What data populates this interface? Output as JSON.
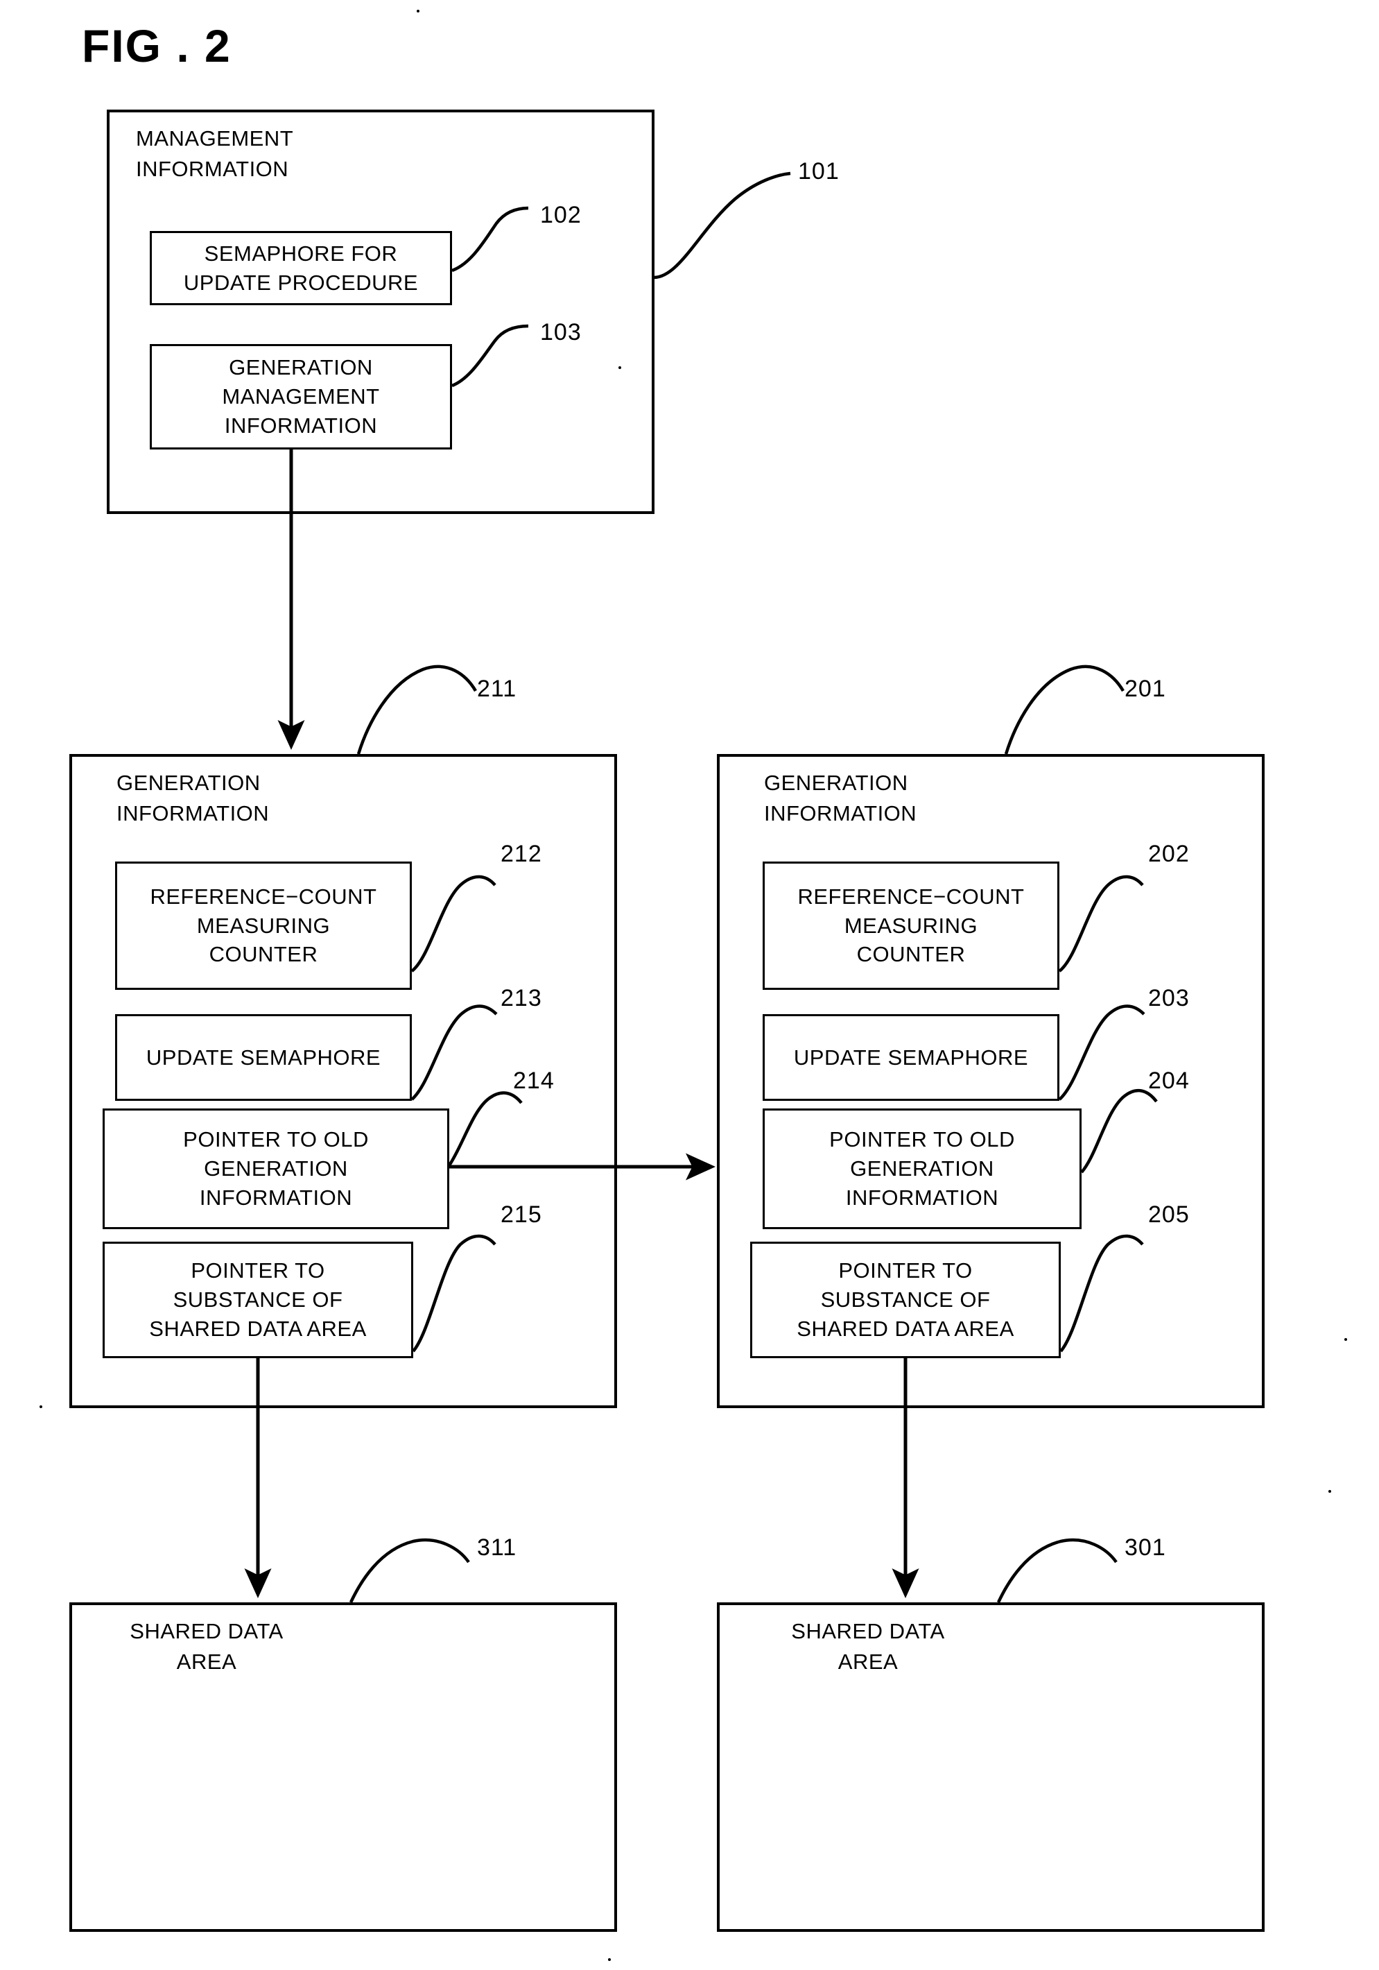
{
  "figure": {
    "title": "FIG . 2"
  },
  "management_information": {
    "heading": "MANAGEMENT\nINFORMATION",
    "ref": "101",
    "children": [
      {
        "label": "SEMAPHORE FOR\nUPDATE PROCEDURE",
        "ref": "102"
      },
      {
        "label": "GENERATION\nMANAGEMENT\nINFORMATION",
        "ref": "103"
      }
    ]
  },
  "generation_information_left": {
    "heading": "GENERATION\nINFORMATION",
    "ref": "211",
    "children": [
      {
        "label": "REFERENCE−COUNT\nMEASURING\nCOUNTER",
        "ref": "212"
      },
      {
        "label": "UPDATE SEMAPHORE",
        "ref": "213"
      },
      {
        "label": "POINTER TO OLD\nGENERATION\nINFORMATION",
        "ref": "214"
      },
      {
        "label": "POINTER TO\nSUBSTANCE OF\nSHARED DATA AREA",
        "ref": "215"
      }
    ]
  },
  "generation_information_right": {
    "heading": "GENERATION\nINFORMATION",
    "ref": "201",
    "children": [
      {
        "label": "REFERENCE−COUNT\nMEASURING\nCOUNTER",
        "ref": "202"
      },
      {
        "label": "UPDATE SEMAPHORE",
        "ref": "203"
      },
      {
        "label": "POINTER TO OLD\nGENERATION\nINFORMATION",
        "ref": "204"
      },
      {
        "label": "POINTER TO\nSUBSTANCE OF\nSHARED DATA AREA",
        "ref": "205"
      }
    ]
  },
  "shared_data_area_left": {
    "heading": "SHARED DATA\nAREA",
    "ref": "311"
  },
  "shared_data_area_right": {
    "heading": "SHARED DATA\nAREA",
    "ref": "301"
  },
  "colors": {
    "ink": "#000000",
    "paper": "#ffffff"
  }
}
